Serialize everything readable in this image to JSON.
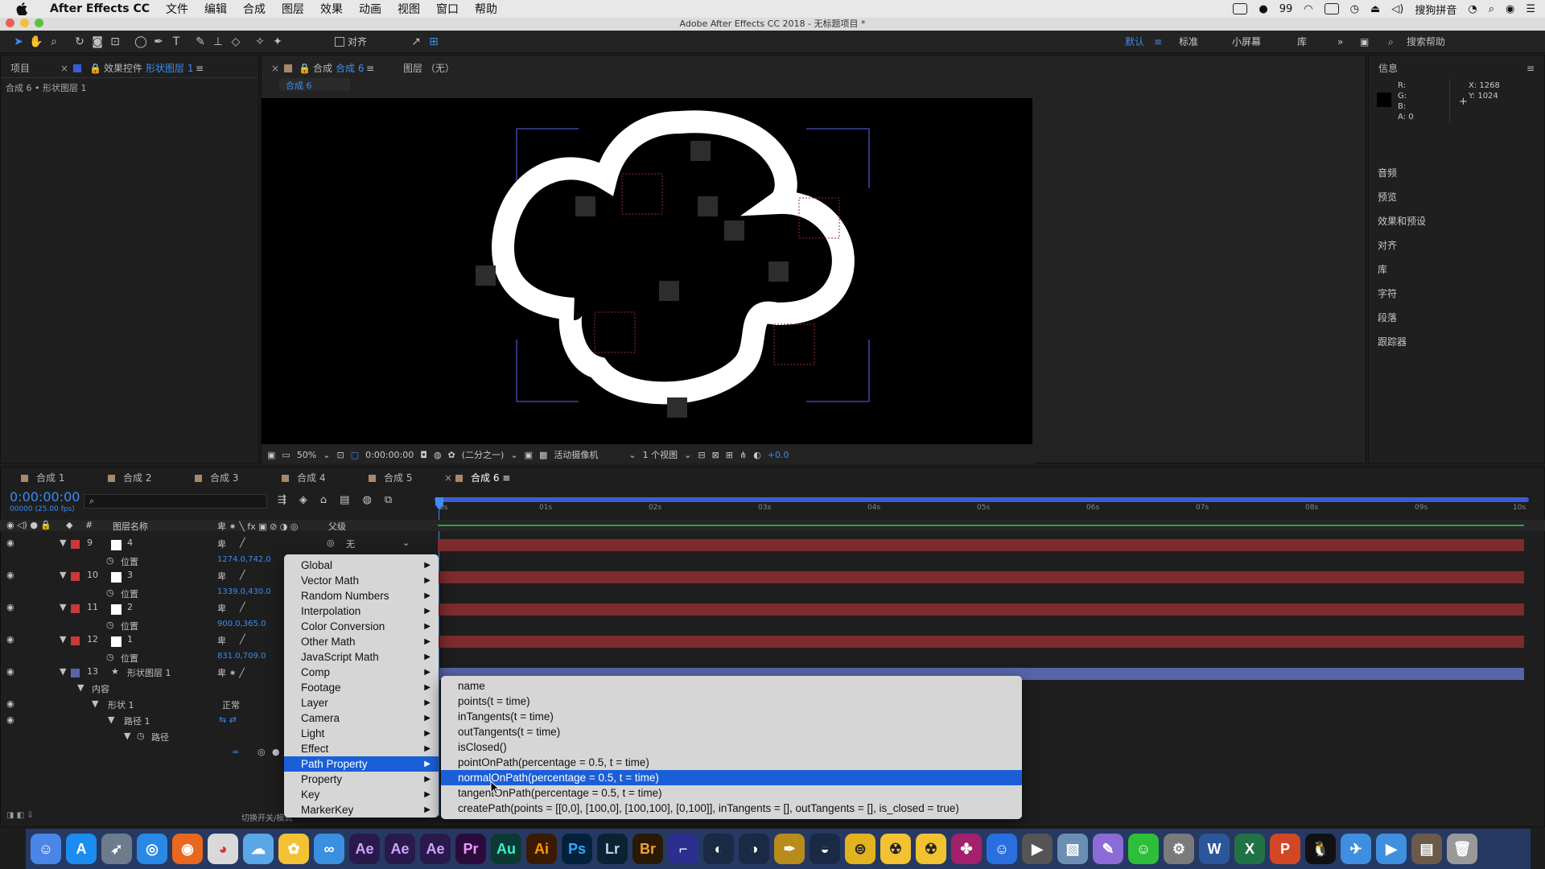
{
  "menubar": {
    "app": "After Effects CC",
    "items": [
      "文件",
      "编辑",
      "合成",
      "图层",
      "效果",
      "动画",
      "视图",
      "窗口",
      "帮助"
    ],
    "battery": "99",
    "input_method": "搜狗拼音"
  },
  "window": {
    "title": "Adobe After Effects CC 2018 - 无标题项目 *"
  },
  "toolbar": {
    "snap_label": "对齐",
    "workspaces": [
      "默认",
      "标准",
      "小屏幕",
      "库"
    ],
    "search_placeholder": "搜索帮助"
  },
  "left_panel": {
    "tab_project": "项目",
    "tab_effects": "效果控件",
    "tab_effects_target": "形状图层 1",
    "breadcrumb": "合成 6 • 形状图层 1"
  },
  "viewer": {
    "tab_comp": "合成",
    "tab_comp_name": "合成 6",
    "tab_layer": "图层 （无）",
    "breadcrumb": "合成 6",
    "zoom": "50%",
    "timecode": "0:00:00:00",
    "resolution": "(二分之一)",
    "camera": "活动摄像机",
    "views": "1 个视图",
    "exposure": "+0.0"
  },
  "info_panel": {
    "title": "信息",
    "r": "R:",
    "g": "G:",
    "b": "B:",
    "a": "A:  0",
    "x": "X: 1268",
    "y": "Y: 1024",
    "sections": [
      "音频",
      "预览",
      "效果和预设",
      "对齐",
      "库",
      "字符",
      "段落",
      "跟踪器"
    ]
  },
  "timeline": {
    "tabs": [
      "合成 1",
      "合成 2",
      "合成 3",
      "合成 4",
      "合成 5",
      "合成 6"
    ],
    "current_time": "0:00:00:00",
    "frame_info": "00000 (25.00 fps)",
    "col_name": "图层名称",
    "col_parent": "父级",
    "parent_value": "无",
    "ruler": [
      "0s",
      "01s",
      "02s",
      "03s",
      "04s",
      "05s",
      "06s",
      "07s",
      "08s",
      "09s",
      "10s"
    ],
    "layers": [
      {
        "num": "9",
        "name": "4",
        "prop": "位置",
        "value": "1274.0,742.0"
      },
      {
        "num": "10",
        "name": "3",
        "prop": "位置",
        "value": "1339.0,430.0"
      },
      {
        "num": "11",
        "name": "2",
        "prop": "位置",
        "value": "900.0,365.0"
      },
      {
        "num": "12",
        "name": "1",
        "prop": "位置",
        "value": "831.0,709.0"
      }
    ],
    "shape_layer": {
      "num": "13",
      "name": "形状图层 1",
      "content": "内容",
      "shape": "形状 1",
      "blend": "正常",
      "path_group": "路径 1",
      "path": "路径"
    },
    "footer": "切换开关/模式"
  },
  "context_menu": {
    "items": [
      "Global",
      "Vector Math",
      "Random Numbers",
      "Interpolation",
      "Color Conversion",
      "Other Math",
      "JavaScript Math",
      "Comp",
      "Footage",
      "Layer",
      "Camera",
      "Light",
      "Effect",
      "Path Property",
      "Property",
      "Key",
      "MarkerKey"
    ],
    "selected": "Path Property"
  },
  "submenu": {
    "items": [
      "name",
      "points(t = time)",
      "inTangents(t = time)",
      "outTangents(t = time)",
      "isClosed()",
      "pointOnPath(percentage = 0.5, t = time)",
      "normalOnPath(percentage = 0.5, t = time)",
      "tangentOnPath(percentage = 0.5, t = time)",
      "createPath(points = [[0,0], [100,0], [100,100], [0,100]], inTangents = [], outTangents = [], is_closed = true)"
    ],
    "selected": "normalOnPath(percentage = 0.5, t = time)"
  },
  "dock": {
    "labels": [
      "Ae",
      "Ae",
      "Ae",
      "Pr",
      "Au",
      "Ai",
      "Ps",
      "Lr",
      "Br",
      "W",
      "X",
      "P"
    ]
  },
  "colors": {
    "accent": "#3b8cf3",
    "menu_selected": "#1a5fd7",
    "track_red": "#7e2b2e",
    "track_blue": "#5864a8"
  }
}
